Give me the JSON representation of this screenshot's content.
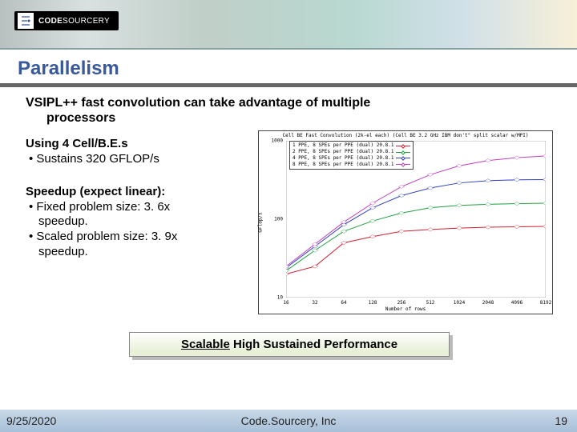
{
  "brand": {
    "code": "CODE",
    "sourcery": "SOURCERY"
  },
  "title": "Parallelism",
  "headline": {
    "line1": "VSIPL++ fast convolution can take advantage of multiple",
    "line2": "processors"
  },
  "using": {
    "head": "Using 4 Cell/B.E.s",
    "b1": "• Sustains 320 GFLOP/s"
  },
  "speedup": {
    "head": "Speedup (expect linear):",
    "fixed1": "• Fixed problem size: 3. 6x",
    "fixed2": "speedup.",
    "scaled1": "• Scaled problem size: 3. 9x",
    "scaled2": "speedup."
  },
  "callout": {
    "scalable": "Scalable",
    "rest": " High Sustained Performance"
  },
  "footer": {
    "date": "9/25/2020",
    "org": "Code.Sourcery, Inc",
    "page": "19"
  },
  "chart_data": {
    "type": "line",
    "title": "Cell BE Fast Convolution (2k-el each) (Cell BE 3.2 GHz IBM don't\" split scalar w/MPI)",
    "xlabel": "Number of rows",
    "ylabel": "GFlop/s",
    "xscale": "log2",
    "yscale": "log",
    "x": [
      16,
      32,
      64,
      128,
      256,
      512,
      1024,
      2048,
      4096,
      8192
    ],
    "ylim": [
      10,
      1000
    ],
    "series": [
      {
        "name": "1 PPE, 8 SPEs per PPE (dual) 20.8.1",
        "color": "#d02030",
        "values": [
          20,
          25,
          50,
          60,
          70,
          74,
          77,
          79,
          80,
          81
        ]
      },
      {
        "name": "2 PPE, 8 SPEs per PPE (dual) 20.8.1",
        "color": "#20a040",
        "values": [
          22,
          40,
          70,
          95,
          120,
          140,
          150,
          155,
          158,
          160
        ]
      },
      {
        "name": "4 PPE, 8 SPEs per PPE (dual) 20.8.1",
        "color": "#3040c0",
        "values": [
          24,
          45,
          85,
          140,
          200,
          250,
          290,
          310,
          318,
          320
        ]
      },
      {
        "name": "8 PPE, 8 SPEs per PPE (dual) 20.8.1",
        "color": "#c040c0",
        "values": [
          25,
          48,
          92,
          160,
          260,
          370,
          480,
          560,
          610,
          640
        ]
      }
    ]
  }
}
